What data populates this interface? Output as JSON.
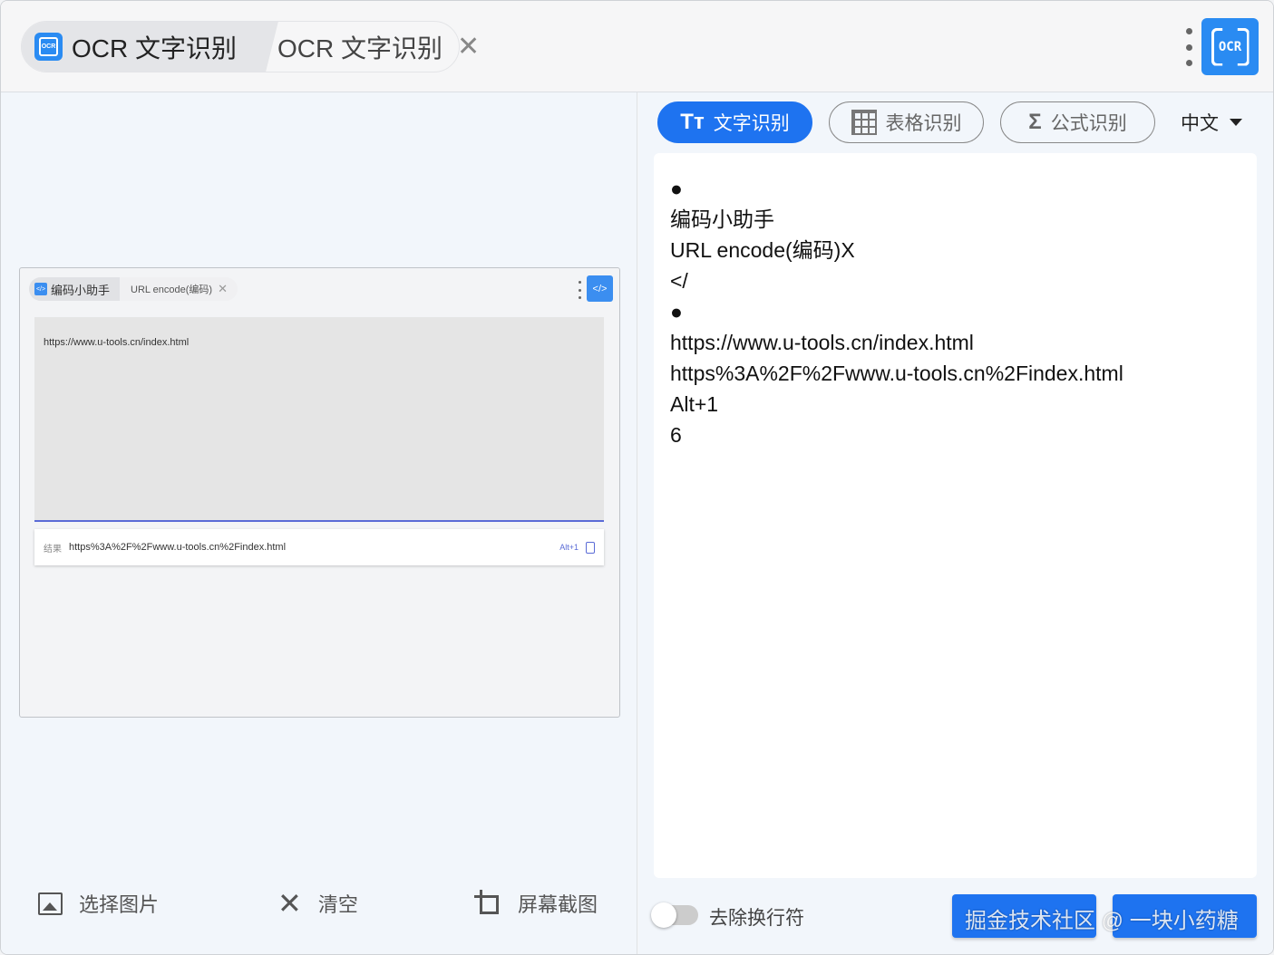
{
  "tabs": [
    {
      "label": "OCR 文字识别",
      "icon": "ocr-icon"
    },
    {
      "label": "OCR 文字识别",
      "close": "✕"
    }
  ],
  "app_logo_text": "OCR",
  "preview": {
    "tabs": [
      {
        "label": "编码小助手",
        "icon": "</>"
      },
      {
        "label": "URL encode(编码)",
        "close": "✕"
      }
    ],
    "logo_glyph": "</>",
    "input_text": "https://www.u-tools.cn/index.html",
    "result_label": "结果",
    "result_value": "https%3A%2F%2Fwww.u-tools.cn%2Findex.html",
    "shortcut": "Alt+1"
  },
  "left_actions": [
    {
      "label": "选择图片",
      "icon": "image-icon"
    },
    {
      "label": "清空",
      "icon": "close-icon"
    },
    {
      "label": "屏幕截图",
      "icon": "crop-icon"
    }
  ],
  "modes": [
    {
      "label": "文字识别",
      "glyph": "Tт",
      "active": true
    },
    {
      "label": "表格识别",
      "icon": "table-icon"
    },
    {
      "label": "公式识别",
      "glyph": "Σ"
    }
  ],
  "language": "中文",
  "output_lines": [
    "●",
    "编码小助手",
    "URL encode(编码)X",
    "</",
    "●",
    "https://www.u-tools.cn/index.html",
    "https%3A%2F%2Fwww.u-tools.cn%2Findex.html",
    "Alt+1",
    "6"
  ],
  "toggle_label": "去除换行符",
  "toggle_on": false,
  "watermark": "掘金技术社区 @ 一块小药糖",
  "colors": {
    "accent": "#1e73f0",
    "brand": "#2a8bf2"
  }
}
